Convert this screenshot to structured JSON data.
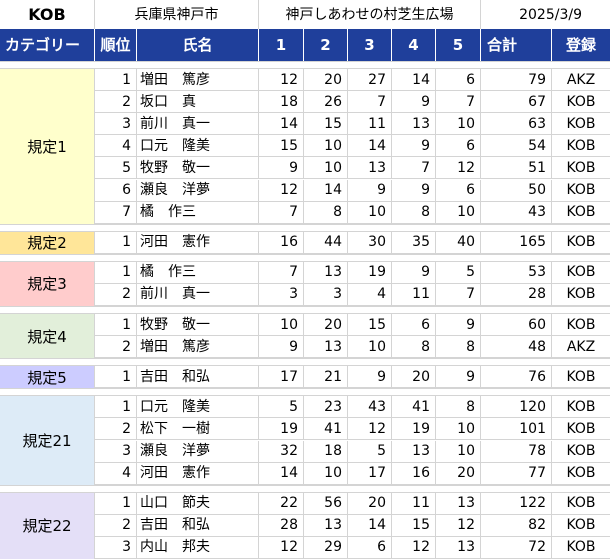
{
  "info": {
    "club": "KOB",
    "location": "兵庫県神戸市",
    "venue": "神戸しあわせの村芝生広場",
    "date": "2025/3/9"
  },
  "headers": [
    "カテゴリー",
    "順位",
    "氏名",
    "1",
    "2",
    "3",
    "4",
    "5",
    "合計",
    "登録"
  ],
  "groups": [
    {
      "category": "規定1",
      "color": "#ffffcc",
      "rows": [
        {
          "rank": "1",
          "name": "増田　篤彦",
          "r1": "12",
          "r2": "20",
          "r3": "27",
          "r4": "14",
          "r5": "6",
          "total": "79",
          "reg": "AKZ"
        },
        {
          "rank": "2",
          "name": "坂口　真",
          "r1": "18",
          "r2": "26",
          "r3": "7",
          "r4": "9",
          "r5": "7",
          "total": "67",
          "reg": "KOB"
        },
        {
          "rank": "3",
          "name": "前川　真一",
          "r1": "14",
          "r2": "15",
          "r3": "11",
          "r4": "13",
          "r5": "10",
          "total": "63",
          "reg": "KOB"
        },
        {
          "rank": "4",
          "name": "口元　隆美",
          "r1": "15",
          "r2": "10",
          "r3": "14",
          "r4": "9",
          "r5": "6",
          "total": "54",
          "reg": "KOB"
        },
        {
          "rank": "5",
          "name": "牧野　敬一",
          "r1": "9",
          "r2": "10",
          "r3": "13",
          "r4": "7",
          "r5": "12",
          "total": "51",
          "reg": "KOB"
        },
        {
          "rank": "6",
          "name": "瀬良　洋夢",
          "r1": "12",
          "r2": "14",
          "r3": "9",
          "r4": "9",
          "r5": "6",
          "total": "50",
          "reg": "KOB"
        },
        {
          "rank": "7",
          "name": "橘　作三",
          "r1": "7",
          "r2": "8",
          "r3": "10",
          "r4": "8",
          "r5": "10",
          "total": "43",
          "reg": "KOB"
        }
      ]
    },
    {
      "category": "規定2",
      "color": "#ffe699",
      "rows": [
        {
          "rank": "1",
          "name": "河田　憲作",
          "r1": "16",
          "r2": "44",
          "r3": "30",
          "r4": "35",
          "r5": "40",
          "total": "165",
          "reg": "KOB"
        }
      ]
    },
    {
      "category": "規定3",
      "color": "#ffcccc",
      "rows": [
        {
          "rank": "1",
          "name": "橘　作三",
          "r1": "7",
          "r2": "13",
          "r3": "19",
          "r4": "9",
          "r5": "5",
          "total": "53",
          "reg": "KOB"
        },
        {
          "rank": "2",
          "name": "前川　真一",
          "r1": "3",
          "r2": "3",
          "r3": "4",
          "r4": "11",
          "r5": "7",
          "total": "28",
          "reg": "KOB"
        }
      ]
    },
    {
      "category": "規定4",
      "color": "#e2efda",
      "rows": [
        {
          "rank": "1",
          "name": "牧野　敬一",
          "r1": "10",
          "r2": "20",
          "r3": "15",
          "r4": "6",
          "r5": "9",
          "total": "60",
          "reg": "KOB"
        },
        {
          "rank": "2",
          "name": "増田　篤彦",
          "r1": "9",
          "r2": "13",
          "r3": "10",
          "r4": "8",
          "r5": "8",
          "total": "48",
          "reg": "AKZ"
        }
      ]
    },
    {
      "category": "規定5",
      "color": "#ccccff",
      "rows": [
        {
          "rank": "1",
          "name": "吉田　和弘",
          "r1": "17",
          "r2": "21",
          "r3": "9",
          "r4": "20",
          "r5": "9",
          "total": "76",
          "reg": "KOB"
        }
      ]
    },
    {
      "category": "規定21",
      "color": "#ddebf7",
      "rows": [
        {
          "rank": "1",
          "name": "口元　隆美",
          "r1": "5",
          "r2": "23",
          "r3": "43",
          "r4": "41",
          "r5": "8",
          "total": "120",
          "reg": "KOB"
        },
        {
          "rank": "2",
          "name": "松下　一樹",
          "r1": "19",
          "r2": "41",
          "r3": "12",
          "r4": "19",
          "r5": "10",
          "total": "101",
          "reg": "KOB"
        },
        {
          "rank": "3",
          "name": "瀬良　洋夢",
          "r1": "32",
          "r2": "18",
          "r3": "5",
          "r4": "13",
          "r5": "10",
          "total": "78",
          "reg": "KOB"
        },
        {
          "rank": "4",
          "name": "河田　憲作",
          "r1": "14",
          "r2": "10",
          "r3": "17",
          "r4": "16",
          "r5": "20",
          "total": "77",
          "reg": "KOB"
        }
      ]
    },
    {
      "category": "規定22",
      "color": "#e4dff7",
      "rows": [
        {
          "rank": "1",
          "name": "山口　節夫",
          "r1": "22",
          "r2": "56",
          "r3": "20",
          "r4": "11",
          "r5": "13",
          "total": "122",
          "reg": "KOB"
        },
        {
          "rank": "2",
          "name": "吉田　和弘",
          "r1": "28",
          "r2": "13",
          "r3": "14",
          "r4": "15",
          "r5": "12",
          "total": "82",
          "reg": "KOB"
        },
        {
          "rank": "3",
          "name": "内山　邦夫",
          "r1": "12",
          "r2": "29",
          "r3": "6",
          "r4": "12",
          "r5": "13",
          "total": "72",
          "reg": "KOB"
        }
      ]
    }
  ]
}
